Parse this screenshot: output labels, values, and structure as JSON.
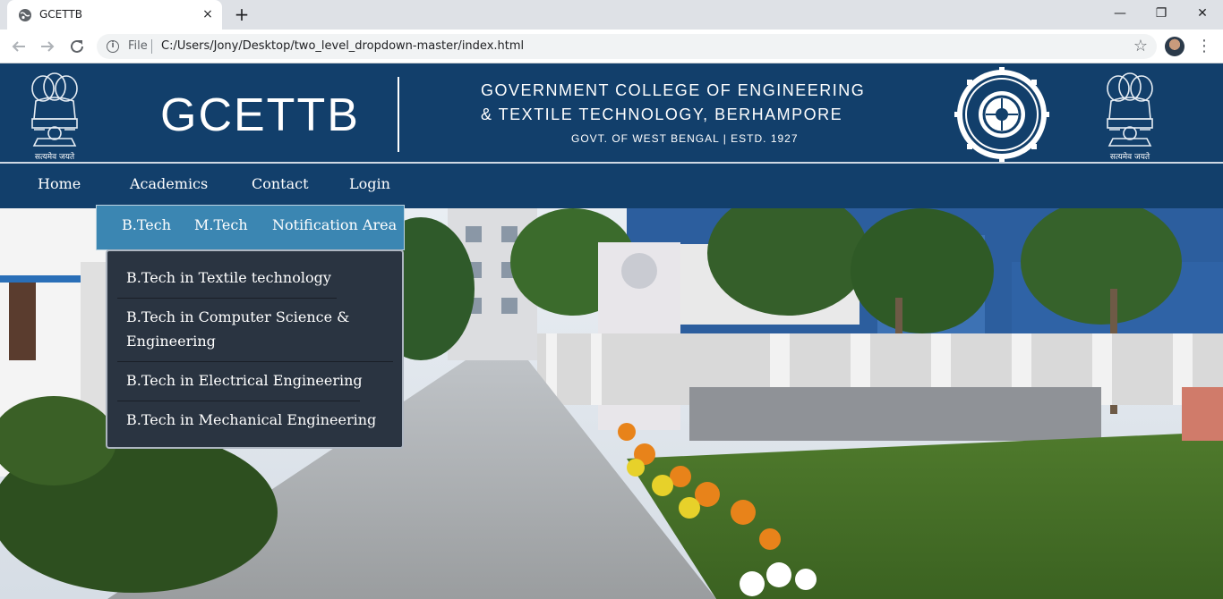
{
  "browser": {
    "tab_title": "GCETTB",
    "tab_close": "×",
    "new_tab": "+",
    "file_label": "File",
    "url": "C:/Users/Jony/Desktop/two_level_dropdown-master/index.html",
    "window_controls": {
      "minimize": "—",
      "restore": "❐",
      "close": "✕"
    },
    "nav_icons": [
      "back-arrow-icon",
      "forward-arrow-icon",
      "reload-icon"
    ]
  },
  "header": {
    "brand": "GCETTB",
    "college_line1": "GOVERNMENT COLLEGE OF ENGINEERING",
    "college_line2": "& TEXTILE TECHNOLOGY, BERHAMPORE",
    "college_sub": "GOVT. OF WEST BENGAL | ESTD. 1927",
    "emblem_caption": "सत्यमेव जयते",
    "colors": {
      "header_bg": "#123f6b",
      "submenu_bg": "#3b86b2",
      "dropdown_bg": "#2a3441"
    }
  },
  "nav": {
    "items": [
      "Home",
      "Academics",
      "Contact",
      "Login"
    ]
  },
  "academics_menu": {
    "items": [
      "B.Tech",
      "M.Tech",
      "Notification Area"
    ]
  },
  "btech_menu": {
    "items": [
      "B.Tech in Textile technology",
      "B.Tech in Computer Science & Engineering",
      "B.Tech in Electrical Engineering",
      "B.Tech in Mechanical Engineering"
    ]
  }
}
